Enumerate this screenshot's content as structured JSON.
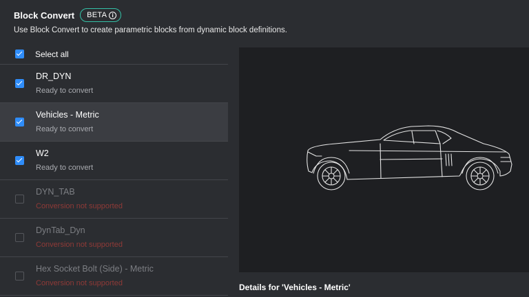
{
  "header": {
    "title": "Block Convert",
    "badge": "BETA",
    "subtitle": "Use Block Convert to create parametric blocks from dynamic block definitions."
  },
  "list": {
    "select_all_label": "Select all",
    "select_all_checked": true,
    "items": [
      {
        "name": "DR_DYN",
        "status": "Ready to convert",
        "checked": true,
        "enabled": true,
        "selected": false
      },
      {
        "name": "Vehicles - Metric",
        "status": "Ready to convert",
        "checked": true,
        "enabled": true,
        "selected": true
      },
      {
        "name": "W2",
        "status": "Ready to convert",
        "checked": true,
        "enabled": true,
        "selected": false
      },
      {
        "name": "DYN_TAB",
        "status": "Conversion not supported",
        "checked": false,
        "enabled": false,
        "selected": false
      },
      {
        "name": "DynTab_Dyn",
        "status": "Conversion not supported",
        "checked": false,
        "enabled": false,
        "selected": false
      },
      {
        "name": "Hex Socket Bolt (Side) - Metric",
        "status": "Conversion not supported",
        "checked": false,
        "enabled": false,
        "selected": false
      }
    ]
  },
  "details": {
    "label": "Details for 'Vehicles - Metric'"
  },
  "colors": {
    "accent": "#2f8dfa",
    "beta_border": "#34c2a8",
    "error_text": "#8f3a37",
    "background": "#2b2d31",
    "preview_background": "#1e1f22"
  },
  "icons": {
    "badge_icon": "info-icon",
    "preview_drawing": "car-side-outline"
  }
}
